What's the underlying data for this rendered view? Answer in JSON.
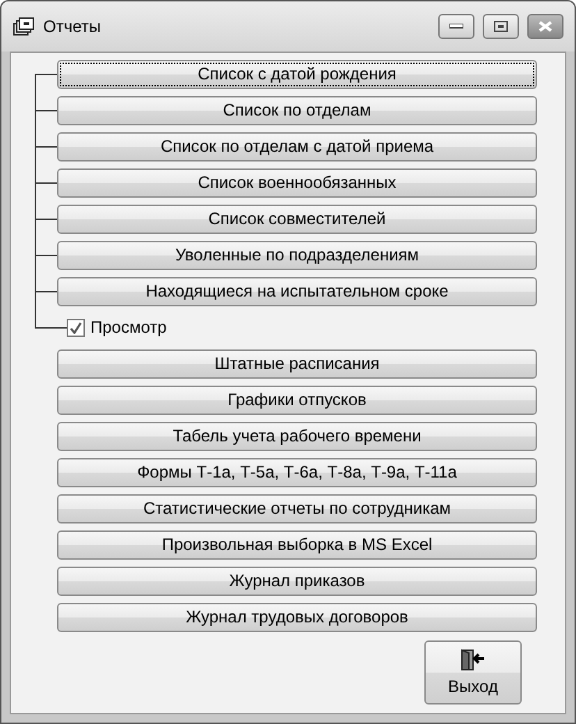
{
  "window": {
    "title": "Отчеты"
  },
  "tree_buttons": [
    {
      "label": "Список с датой рождения",
      "focused": true
    },
    {
      "label": "Список по отделам",
      "focused": false
    },
    {
      "label": "Список по отделам с датой приема",
      "focused": false
    },
    {
      "label": "Список военнообязанных",
      "focused": false
    },
    {
      "label": "Список совместителей",
      "focused": false
    },
    {
      "label": "Уволенные по подразделениям",
      "focused": false
    },
    {
      "label": "Находящиеся на испытательном сроке",
      "focused": false
    }
  ],
  "preview": {
    "label": "Просмотр",
    "checked": true
  },
  "buttons": [
    "Штатные расписания",
    "Графики отпусков",
    "Табель учета рабочего времени",
    "Формы Т-1а, Т-5а, Т-6а, Т-8а, Т-9а, Т-11а",
    "Статистические отчеты по сотрудникам",
    "Произвольная выборка в MS Excel",
    "Журнал приказов",
    "Журнал трудовых договоров"
  ],
  "exit_button": {
    "label": "Выход"
  }
}
